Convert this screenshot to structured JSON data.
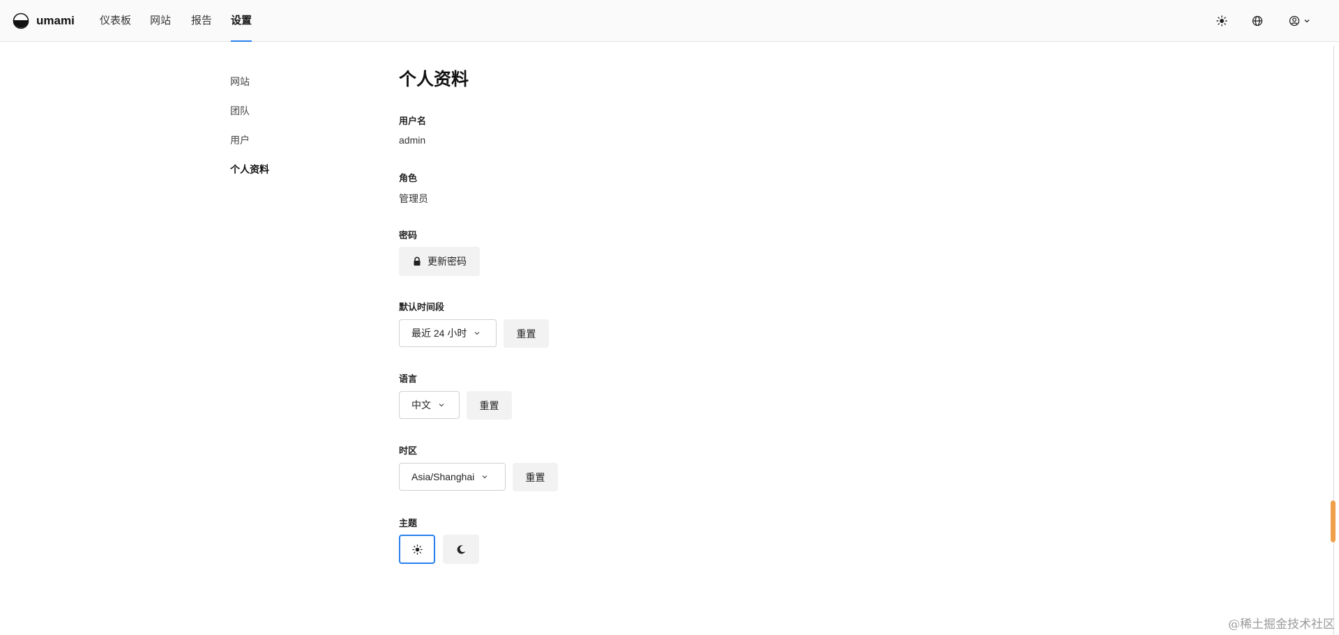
{
  "app": {
    "name": "umami"
  },
  "nav": {
    "items": [
      {
        "label": "仪表板",
        "active": false
      },
      {
        "label": "网站",
        "active": false
      },
      {
        "label": "报告",
        "active": false
      },
      {
        "label": "设置",
        "active": true
      }
    ]
  },
  "header_icons": [
    "sun-icon",
    "globe-icon",
    "user-circle-icon",
    "chevron-down-icon"
  ],
  "sidebar": {
    "items": [
      {
        "label": "网站",
        "active": false
      },
      {
        "label": "团队",
        "active": false
      },
      {
        "label": "用户",
        "active": false
      },
      {
        "label": "个人资料",
        "active": true
      }
    ]
  },
  "profile": {
    "title": "个人资料",
    "username": {
      "label": "用户名",
      "value": "admin"
    },
    "role": {
      "label": "角色",
      "value": "管理员"
    },
    "password": {
      "label": "密码",
      "button": "更新密码",
      "icon": "lock-icon"
    },
    "date_range": {
      "label": "默认时间段",
      "selected": "最近 24 小时",
      "reset": "重置"
    },
    "language": {
      "label": "语言",
      "selected": "中文",
      "reset": "重置"
    },
    "timezone": {
      "label": "时区",
      "selected": "Asia/Shanghai",
      "reset": "重置"
    },
    "theme": {
      "label": "主题",
      "options": [
        "sun-icon",
        "moon-icon"
      ],
      "selected": "sun-icon"
    }
  },
  "colors": {
    "accent": "#2680eb",
    "scroll_thumb": "#f0a04b"
  },
  "watermark": "@稀土掘金技术社区"
}
